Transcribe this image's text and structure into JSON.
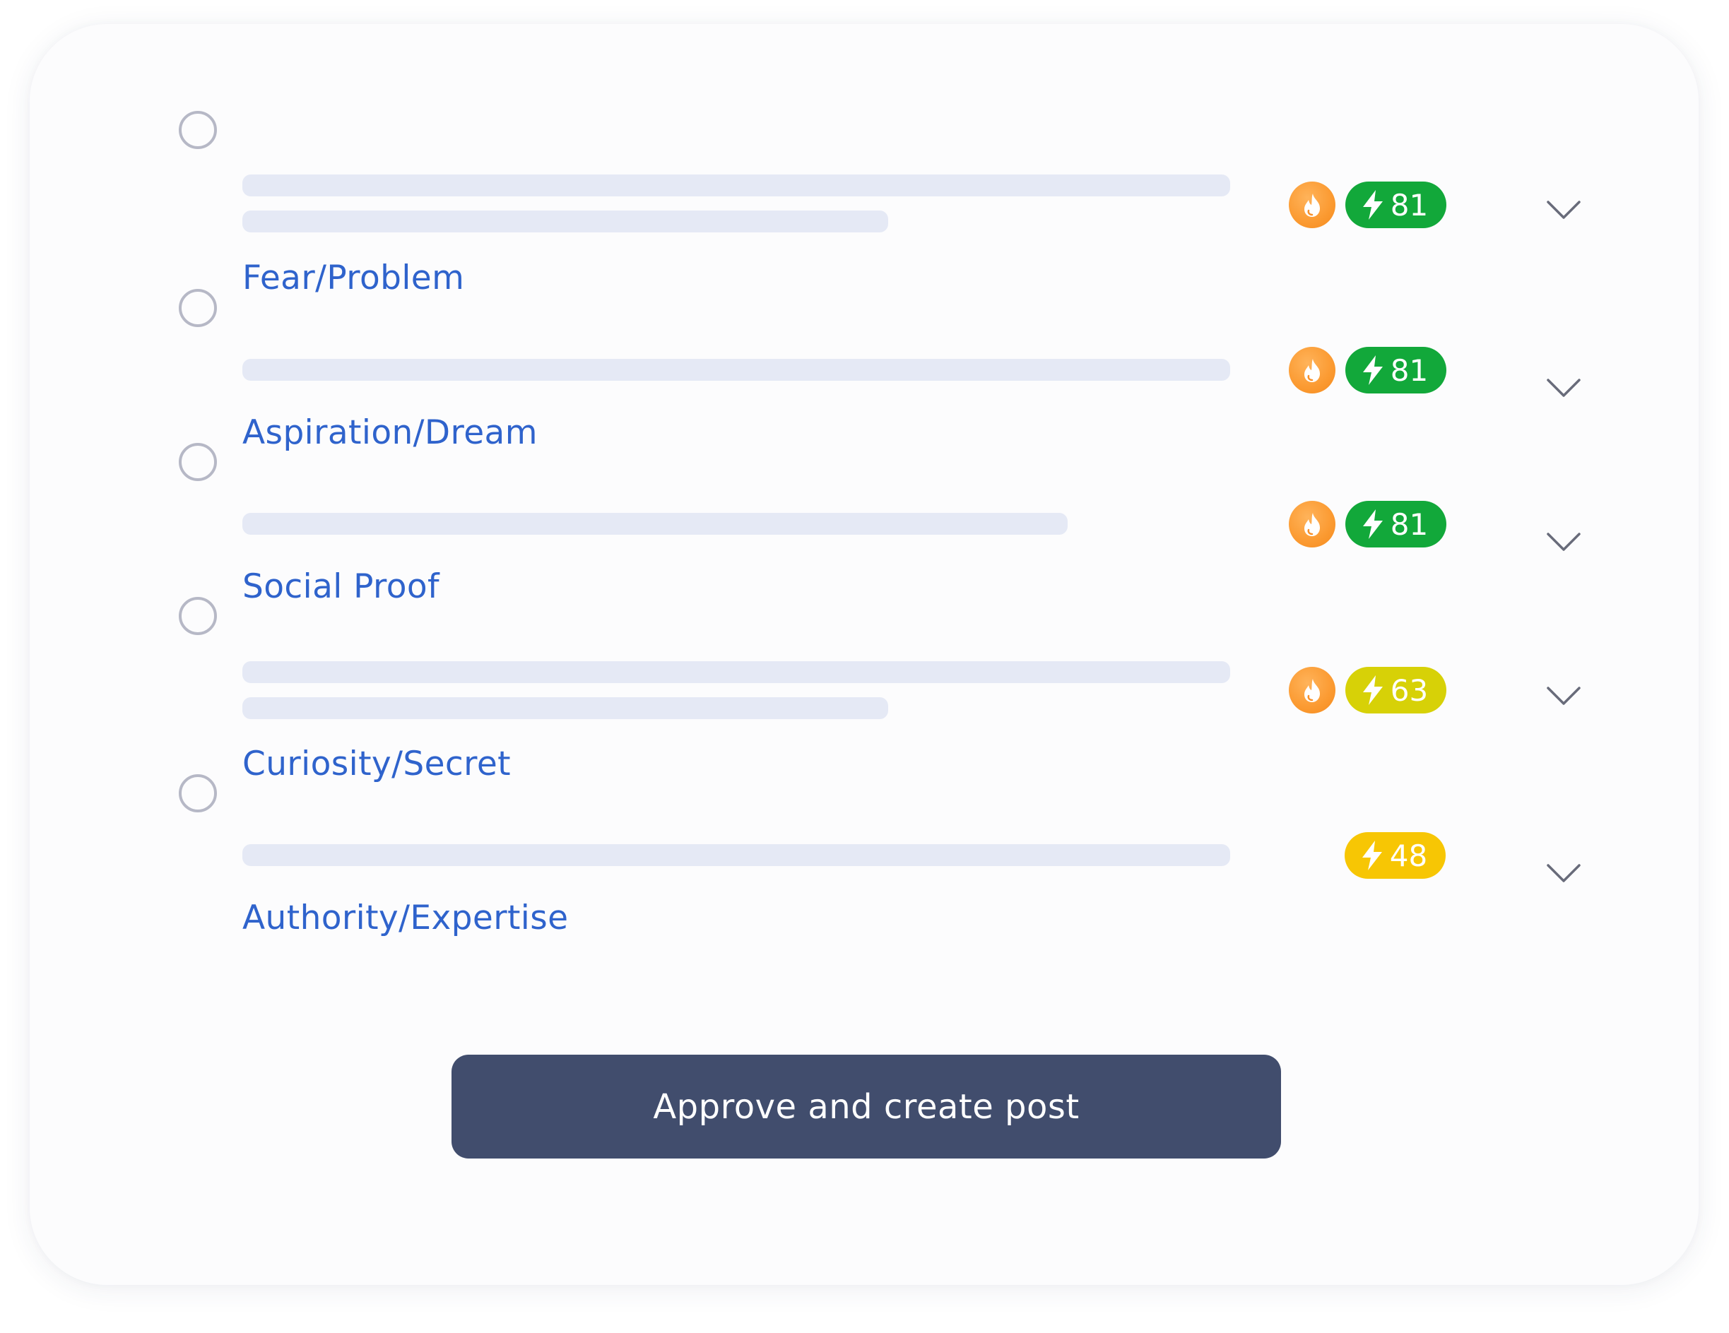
{
  "options": [
    {
      "label": "Fear/Problem",
      "placeholder_lines": 2,
      "has_fire": true,
      "score": "81",
      "score_color": "#12a83a"
    },
    {
      "label": "Aspiration/Dream",
      "placeholder_lines": 1,
      "has_fire": true,
      "score": "81",
      "score_color": "#12a83a"
    },
    {
      "label": "Social Proof",
      "placeholder_lines": 1,
      "has_fire": true,
      "score": "81",
      "score_color": "#12a83a"
    },
    {
      "label": "Curiosity/Secret",
      "placeholder_lines": 2,
      "has_fire": true,
      "score": "63",
      "score_color": "#d7d107"
    },
    {
      "label": "Authority/Expertise",
      "placeholder_lines": 1,
      "has_fire": false,
      "score": "48",
      "score_color": "#f7c604"
    }
  ],
  "icons": {
    "radio": "radio-unselected-icon",
    "fire": "fire-icon",
    "score": "lightning-bolt-icon",
    "expand": "chevron-down-icon"
  },
  "colors": {
    "label": "#2f63cc",
    "placeholder": "#e5e9f5",
    "fire": "#fb9a31",
    "button": "#414d6d"
  },
  "approve_button": {
    "label": "Approve and create post"
  }
}
